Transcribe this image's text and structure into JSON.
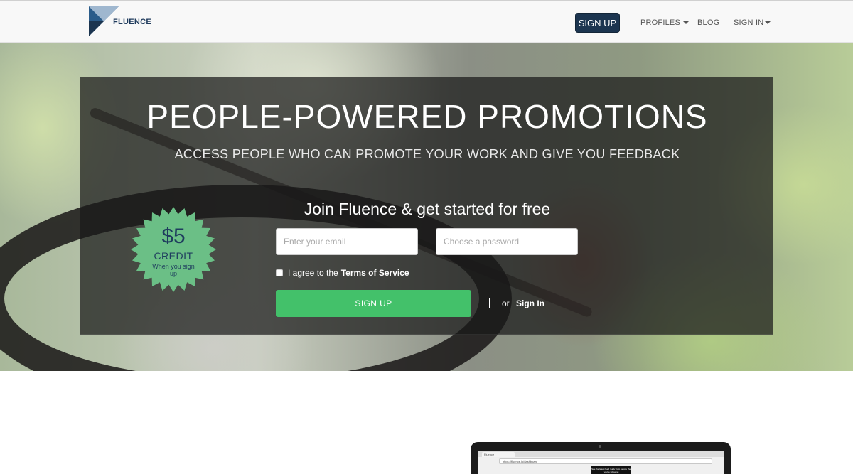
{
  "navbar": {
    "logo_text": "FLUENCE",
    "signup_label": "SIGN UP",
    "profiles_label": "PROFILES",
    "blog_label": "BLOG",
    "signin_label": "SIGN IN"
  },
  "hero": {
    "title": "PEOPLE-POWERED PROMOTIONS",
    "subtitle": "ACCESS PEOPLE WHO CAN PROMOTE YOUR WORK AND GIVE YOU FEEDBACK",
    "join_text": "Join Fluence & get started for free",
    "email_placeholder": "Enter your email",
    "password_placeholder": "Choose a password",
    "terms_prefix": "I agree to the",
    "terms_link": "Terms of Service",
    "signup_button": "SIGN UP",
    "or_text": "or",
    "signin_link": "Sign In"
  },
  "badge": {
    "amount": "$5",
    "credit": "CREDIT",
    "note": "When you sign up"
  },
  "laptop": {
    "tab_label": "Fluence",
    "url": "https://fluence.io/dashboard",
    "tooltip": "See the latest feed ready from people that you're following"
  },
  "colors": {
    "brand_navy": "#1c3550",
    "accent_green": "#43c16a",
    "badge_green": "#6bbf86"
  }
}
